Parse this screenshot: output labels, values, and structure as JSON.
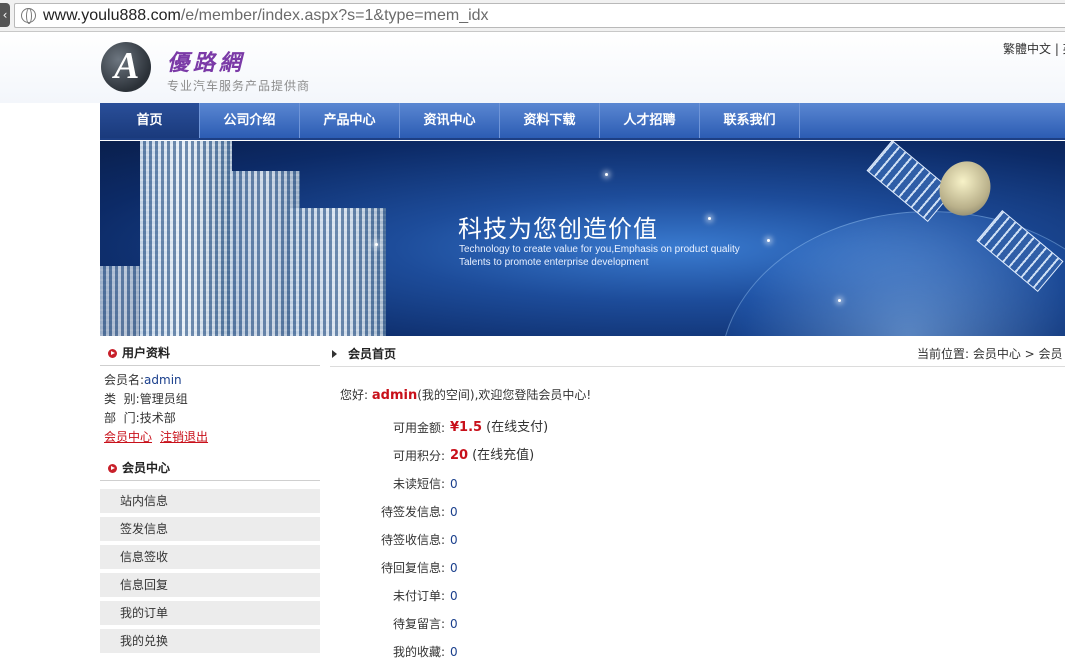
{
  "browser": {
    "url_host": "www.youlu888.com",
    "url_path": "/e/member/index.aspx?s=1&type=mem_idx"
  },
  "header": {
    "logo_letter": "A",
    "site_name": "優路網",
    "tagline": "专业汽车服务产品提供商",
    "lang_link": "繁體中文 | 英"
  },
  "nav": {
    "items": [
      {
        "label": "首页"
      },
      {
        "label": "公司介绍"
      },
      {
        "label": "产品中心"
      },
      {
        "label": "资讯中心"
      },
      {
        "label": "资料下载"
      },
      {
        "label": "人才招聘"
      },
      {
        "label": "联系我们"
      }
    ]
  },
  "banner": {
    "slogan": "科技为您创造价值",
    "line1": "Technology to create value for you,Emphasis on product quality",
    "line2": "Talents to promote enterprise development"
  },
  "sidebar": {
    "profile_title": "用户资料",
    "username_label": "会员名:",
    "username": "admin",
    "type_label": "类  别:",
    "type": "管理员组",
    "dept_label": "部  门:",
    "dept": "技术部",
    "link_center": "会员中心",
    "link_logout": "注销退出",
    "menu_title": "会员中心",
    "menu": [
      {
        "label": "站内信息"
      },
      {
        "label": "签发信息"
      },
      {
        "label": "信息签收"
      },
      {
        "label": "信息回复"
      },
      {
        "label": "我的订单"
      },
      {
        "label": "我的兑换"
      }
    ]
  },
  "main": {
    "title": "会员首页",
    "breadcrumb": "当前位置: 会员中心 > 会员",
    "welcome_prefix": "您好:",
    "welcome_user": "admin",
    "welcome_suffix": "(我的空间),欢迎您登陆会员中心!",
    "stats": [
      {
        "label": "可用金额:",
        "value": "¥1.5",
        "note": "(在线支付)",
        "kind": "money"
      },
      {
        "label": "可用积分:",
        "value": "20",
        "note": "(在线充值)",
        "kind": "pts"
      },
      {
        "label": "未读短信:",
        "value": "0",
        "note": "",
        "kind": "plain"
      },
      {
        "label": "待签发信息:",
        "value": "0",
        "note": "",
        "kind": "plain"
      },
      {
        "label": "待签收信息:",
        "value": "0",
        "note": "",
        "kind": "plain"
      },
      {
        "label": "待回复信息:",
        "value": "0",
        "note": "",
        "kind": "plain"
      },
      {
        "label": "未付订单:",
        "value": "0",
        "note": "",
        "kind": "plain"
      },
      {
        "label": "待复留言:",
        "value": "0",
        "note": "",
        "kind": "plain"
      },
      {
        "label": "我的收藏:",
        "value": "0",
        "note": "",
        "kind": "plain"
      }
    ]
  }
}
